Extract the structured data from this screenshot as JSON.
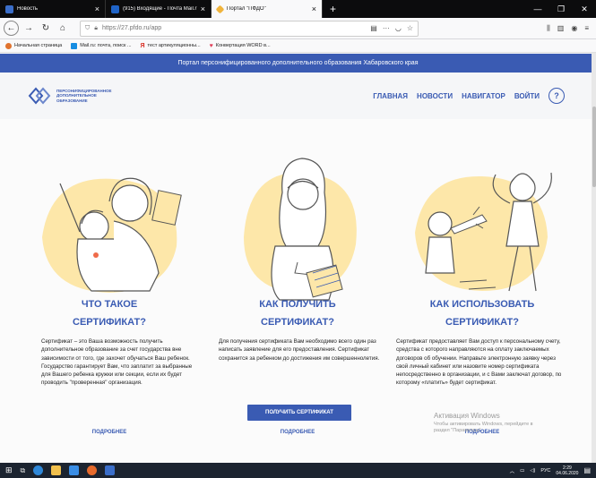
{
  "browser": {
    "tabs": [
      {
        "label": "Новость",
        "color": "#3b6ec9"
      },
      {
        "label": "(915) Входящие - Почта Mail.r",
        "color": "#1f63c6"
      },
      {
        "label": "Портал \"ПФДО\"",
        "color": "#f0b43c"
      }
    ],
    "url": "https://27.pfdo.ru/app",
    "bookmarks": [
      {
        "label": "Начальная страница",
        "color": "#e0732e"
      },
      {
        "label": "Mail.ru: почта, поиск ...",
        "color": "#168de2"
      },
      {
        "label": "тест артикуляционны...",
        "color": "#d93025"
      },
      {
        "label": "Конвертация WORD в...",
        "color": "#e0405a"
      }
    ]
  },
  "site": {
    "banner": "Портал персонифицированного дополнительного образования Хабаровского края",
    "logo_lines": [
      "ПЕРСОНИФИЦИРОВАННОЕ",
      "ДОПОЛНИТЕЛЬНОЕ",
      "ОБРАЗОВАНИЕ"
    ],
    "menu": [
      "ГЛАВНАЯ",
      "НОВОСТИ",
      "НАВИГАТОР",
      "ВОЙТИ"
    ],
    "help": "?"
  },
  "columns": [
    {
      "title_line1": "ЧТО ТАКОЕ",
      "title_line2": "СЕРТИФИКАТ?",
      "text": "Сертификат – это Ваша возможность получить дополнительное образование за счет государства вне зависимости от того, где захочет обучаться Ваш ребенок. Государство гарантирует Вам, что заплатит за выбранные для Вашего ребенка кружки или секции, если их будет проводить \"проверенная\" организация.",
      "more": "ПОДРОБНЕЕ"
    },
    {
      "title_line1": "КАК ПОЛУЧИТЬ",
      "title_line2": "СЕРТИФИКАТ?",
      "text": "Для получения сертификата Вам необходимо всего один раз написать заявление для его предоставления. Сертификат сохранится за ребенком до достижения им совершеннолетия.",
      "button": "ПОЛУЧИТЬ СЕРТИФИКАТ",
      "more": "ПОДРОБНЕЕ"
    },
    {
      "title_line1": "КАК ИСПОЛЬЗОВАТЬ",
      "title_line2": "СЕРТИФИКАТ?",
      "text": "Сертификат предоставляет Вам доступ к персональному счету, средства с которого направляются на оплату заключаемых договоров об обучении. Направьте электронную заявку через свой личный кабинет или назовите номер сертификата непосредственно в организации, и с Вами заключат договор, по которому «платить» будет сертификат.",
      "more": "ПОДРОБНЕЕ"
    }
  ],
  "watermark": {
    "title": "Активация Windows",
    "sub1": "Чтобы активировать Windows, перейдите в",
    "sub2": "раздел \"Параметры\"."
  },
  "taskbar": {
    "lang": "РУС",
    "time": "2:29",
    "date": "04.06.2020"
  },
  "colors": {
    "accent": "#3a5bb3",
    "illustration_bg": "#fde7a9"
  }
}
